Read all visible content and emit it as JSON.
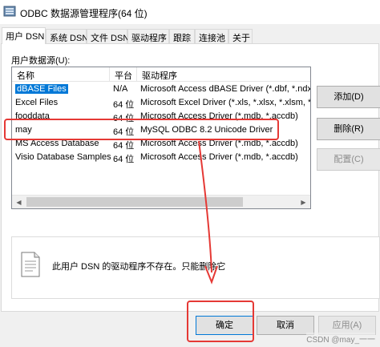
{
  "window": {
    "title": "ODBC 数据源管理程序(64 位)"
  },
  "tabs": [
    {
      "label": "用户 DSN",
      "active": true
    },
    {
      "label": "系统 DSN"
    },
    {
      "label": "文件 DSN"
    },
    {
      "label": "驱动程序"
    },
    {
      "label": "跟踪"
    },
    {
      "label": "连接池"
    },
    {
      "label": "关于"
    }
  ],
  "user_dsn": {
    "section_label": "用户数据源(U):",
    "columns": [
      "名称",
      "平台",
      "驱动程序"
    ],
    "rows": [
      {
        "name": "dBASE Files",
        "platform": "N/A",
        "driver": "Microsoft Access dBASE Driver (*.dbf, *.ndx, *",
        "selected": true
      },
      {
        "name": "Excel Files",
        "platform": "64 位",
        "driver": "Microsoft Excel Driver (*.xls, *.xlsx, *.xlsm, *.xls"
      },
      {
        "name": "fooddata",
        "platform": "64 位",
        "driver": "Microsoft Access Driver (*.mdb, *.accdb)"
      },
      {
        "name": "may",
        "platform": "64 位",
        "driver": "MySQL ODBC 8.2 Unicode Driver"
      },
      {
        "name": "MS Access Database",
        "platform": "64 位",
        "driver": "Microsoft Access Driver (*.mdb, *.accdb)"
      },
      {
        "name": "Visio Database Samples",
        "platform": "64 位",
        "driver": "Microsoft Access Driver (*.mdb, *.accdb)"
      }
    ],
    "buttons": {
      "add": "添加(D)",
      "remove": "删除(R)",
      "configure": "配置(C)"
    },
    "info_text": "此用户 DSN 的驱动程序不存在。只能删除它"
  },
  "dialog_buttons": {
    "ok": "确定",
    "cancel": "取消",
    "apply": "应用(A)"
  },
  "watermark": "CSDN @may_一一",
  "colors": {
    "selection": "#0078d7",
    "annotation": "#e53935"
  }
}
